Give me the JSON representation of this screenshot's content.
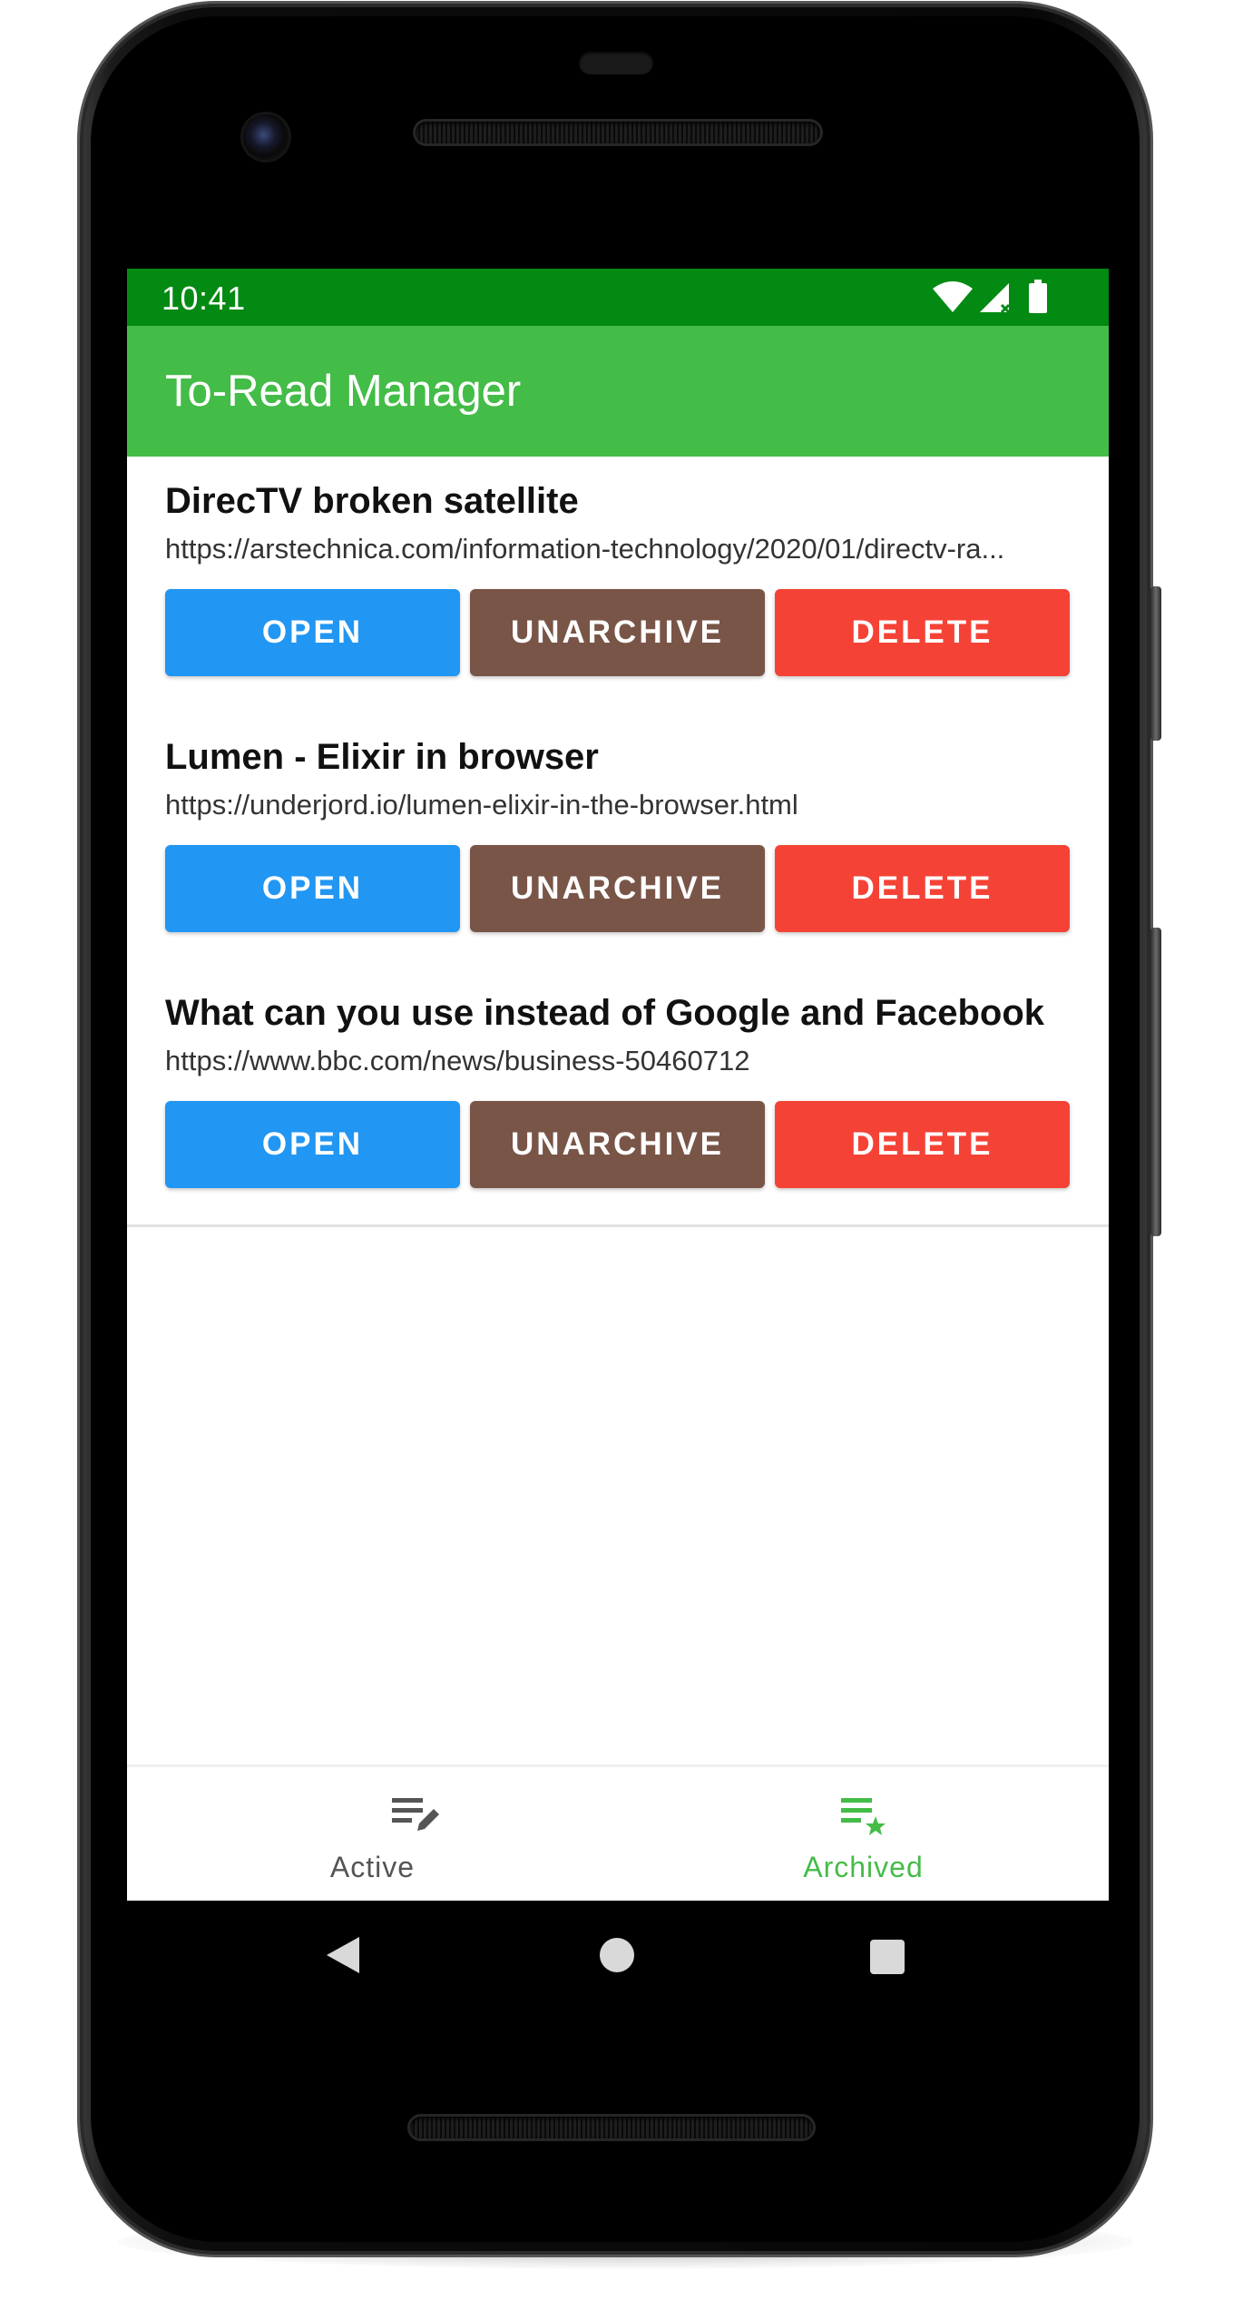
{
  "status_bar": {
    "time": "10:41",
    "color": "#038a12",
    "icons": [
      "wifi-icon",
      "cellular-signal-icon",
      "battery-icon"
    ]
  },
  "app_bar": {
    "title": "To-Read Manager",
    "color": "#44bc48"
  },
  "buttons": {
    "open": "OPEN",
    "unarchive": "UNARCHIVE",
    "delete": "DELETE",
    "colors": {
      "open": "#2196f3",
      "unarchive": "#795548",
      "delete": "#f44336"
    }
  },
  "articles": [
    {
      "title": "DirecTV broken satellite",
      "url": "https://arstechnica.com/information-technology/2020/01/directv-ra..."
    },
    {
      "title": "Lumen - Elixir in browser",
      "url": "https://underjord.io/lumen-elixir-in-the-browser.html"
    },
    {
      "title": "What can you use instead of Google and Facebook",
      "url": "https://www.bbc.com/news/business-50460712"
    }
  ],
  "bottom_nav": {
    "items": [
      {
        "label": "Active",
        "icon": "list-edit-icon",
        "selected": false
      },
      {
        "label": "Archived",
        "icon": "list-star-icon",
        "selected": true
      }
    ],
    "selected_color": "#44bc48",
    "unselected_color": "#555555"
  },
  "system_nav": [
    "back-icon",
    "home-icon",
    "recents-icon"
  ]
}
